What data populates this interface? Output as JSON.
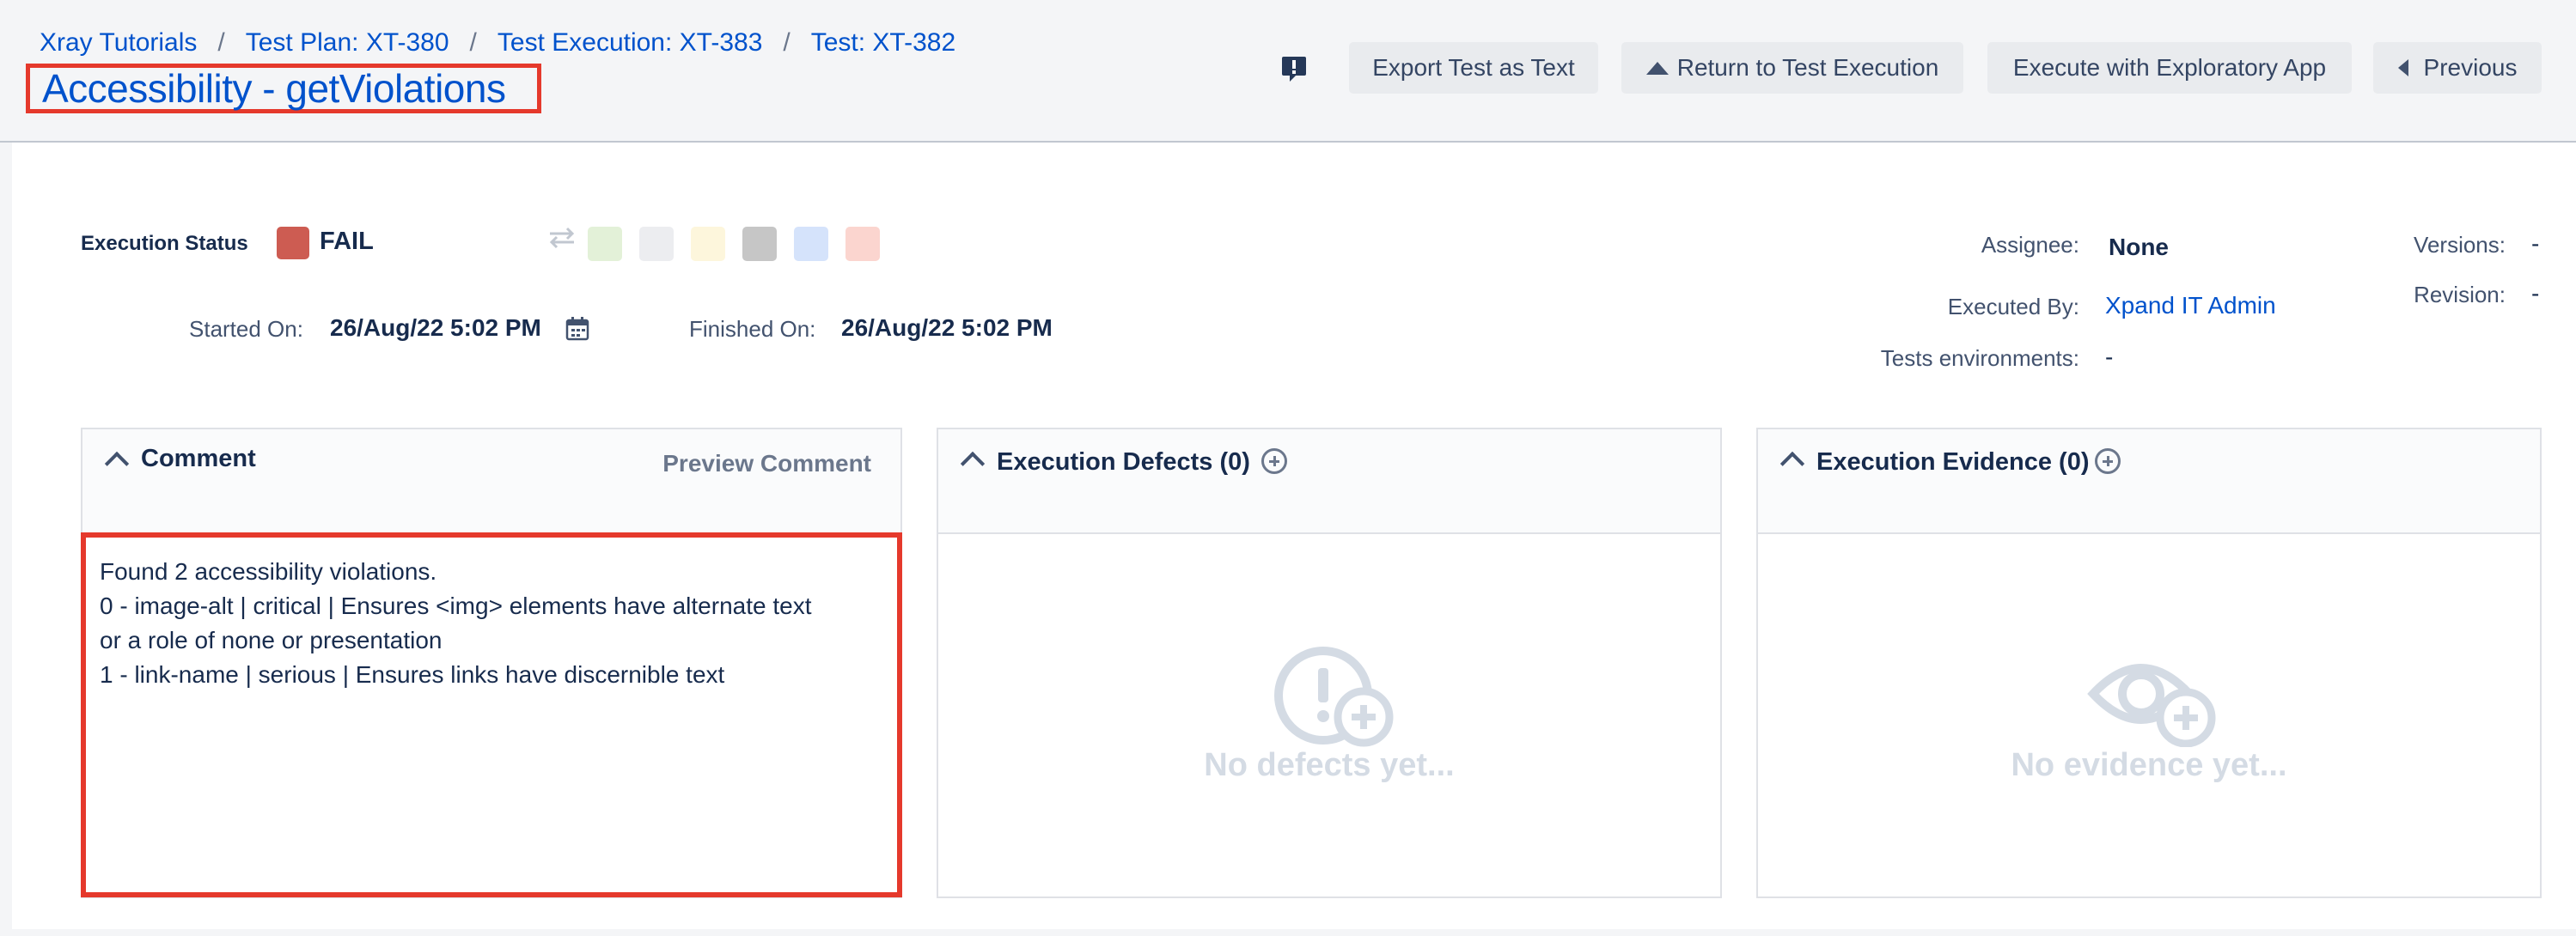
{
  "breadcrumb": [
    "Xray Tutorials",
    "Test Plan: XT-380",
    "Test Execution: XT-383",
    "Test: XT-382"
  ],
  "title": "Accessibility - getViolations",
  "toolbar": {
    "export": "Export Test as Text",
    "return": "Return to Test Execution",
    "exploratory": "Execute with Exploratory App",
    "previous": "Previous"
  },
  "execution": {
    "status_label": "Execution Status",
    "status": "FAIL",
    "status_color": "#cd5c52",
    "status_swatch_colors": [
      "#e3f1d8",
      "#ecedf0",
      "#fdf6dc",
      "#c6c6c6",
      "#d5e3fb",
      "#fbd5cf"
    ],
    "started_label": "Started On:",
    "started": "26/Aug/22 5:02 PM",
    "finished_label": "Finished On:",
    "finished": "26/Aug/22 5:02 PM"
  },
  "meta": {
    "assignee_label": "Assignee:",
    "assignee": "None",
    "executed_by_label": "Executed By:",
    "executed_by": "Xpand IT Admin",
    "env_label": "Tests environments:",
    "env": "-",
    "versions_label": "Versions:",
    "versions": "-",
    "revision_label": "Revision:",
    "revision": "-"
  },
  "comment": {
    "title": "Comment",
    "preview": "Preview Comment",
    "lines": [
      "Found 2 accessibility violations.",
      "0 - image-alt | critical | Ensures <img> elements have alternate text",
      "or a role of none or presentation",
      "1 - link-name | serious | Ensures links have discernible text"
    ]
  },
  "defects": {
    "title": "Execution Defects (0)",
    "empty": "No defects yet..."
  },
  "evidence": {
    "title": "Execution Evidence (0)",
    "empty": "No evidence yet..."
  }
}
